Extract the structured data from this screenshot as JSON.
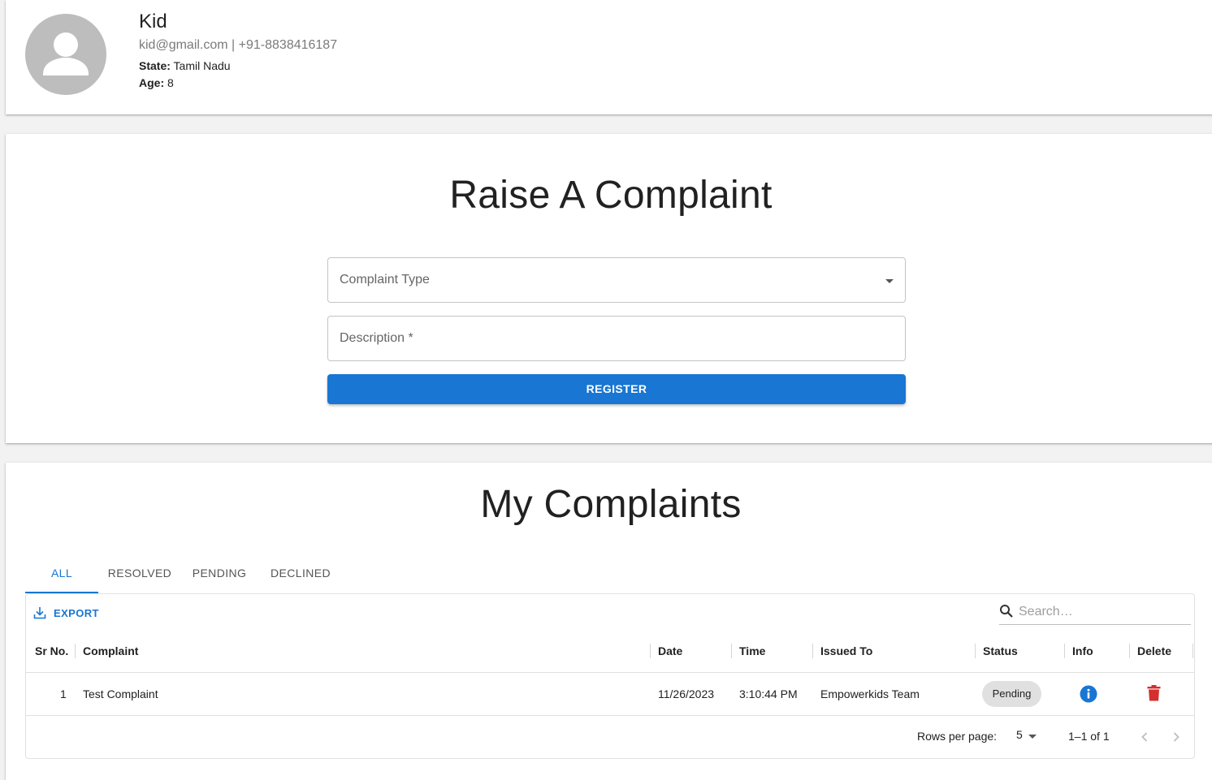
{
  "profile": {
    "name": "Kid",
    "contact": "kid@gmail.com | +91-8838416187",
    "state_label": "State:",
    "state_value": "Tamil Nadu",
    "age_label": "Age:",
    "age_value": "8",
    "avatar_icon": "person-icon"
  },
  "raise": {
    "title": "Raise A Complaint",
    "type_label": "Complaint Type",
    "description_label": "Description *",
    "register_label": "REGISTER"
  },
  "complaints": {
    "title": "My Complaints",
    "tabs": [
      {
        "label": "ALL",
        "active": true
      },
      {
        "label": "RESOLVED",
        "active": false
      },
      {
        "label": "PENDING",
        "active": false
      },
      {
        "label": "DECLINED",
        "active": false
      }
    ],
    "export_label": "EXPORT",
    "search_placeholder": "Search…",
    "columns": [
      "Sr No.",
      "Complaint",
      "Date",
      "Time",
      "Issued To",
      "Status",
      "Info",
      "Delete"
    ],
    "rows": [
      {
        "sr": "1",
        "complaint": "Test Complaint",
        "date": "11/26/2023",
        "time": "3:10:44 PM",
        "issued_to": "Empowerkids Team",
        "status": "Pending"
      }
    ],
    "footer": {
      "rows_per_page_label": "Rows per page:",
      "rows_per_page_value": "5",
      "range": "1–1 of 1"
    }
  },
  "colors": {
    "accent": "#1976d2",
    "delete": "#d32f2f",
    "avatar_bg": "#bdbdbd"
  }
}
